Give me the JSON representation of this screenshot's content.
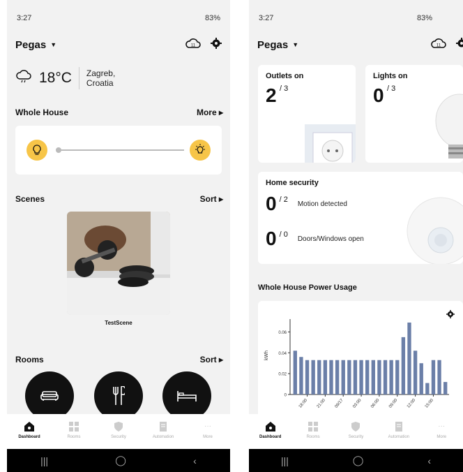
{
  "left": {
    "status": {
      "time": "3:27",
      "battery": "83%"
    },
    "home_name": "Pegas",
    "cloud_badge": "11",
    "weather": {
      "temp": "18°C",
      "city_line1": "Zagreb,",
      "city_line2": "Croatia"
    },
    "whole_house": {
      "title": "Whole House",
      "action": "More"
    },
    "scenes": {
      "title": "Scenes",
      "action": "Sort",
      "scene_name": "TestScene"
    },
    "rooms": {
      "title": "Rooms",
      "action": "Sort"
    },
    "nav": [
      {
        "label": "Dashboard",
        "icon": "home-icon"
      },
      {
        "label": "Rooms",
        "icon": "grid-icon"
      },
      {
        "label": "Security",
        "icon": "shield-icon"
      },
      {
        "label": "Automation",
        "icon": "automation-icon"
      },
      {
        "label": "More",
        "icon": "more-icon"
      }
    ]
  },
  "right": {
    "status": {
      "time": "3:27",
      "battery": "83%"
    },
    "home_name": "Pegas",
    "cloud_badge": "11",
    "outlets": {
      "title": "Outlets on",
      "value": "2",
      "total": "/ 3"
    },
    "lights": {
      "title": "Lights on",
      "value": "0",
      "total": "/ 3"
    },
    "security": {
      "title": "Home security",
      "motion_value": "0",
      "motion_total": "/ 2",
      "motion_label": "Motion detected",
      "doors_value": "0",
      "doors_total": "/ 0",
      "doors_label": "Doors/Windows open"
    },
    "power_title": "Whole House Power Usage",
    "nav": [
      {
        "label": "Dashboard"
      },
      {
        "label": "Rooms"
      },
      {
        "label": "Security"
      },
      {
        "label": "Automation"
      },
      {
        "label": "More"
      }
    ]
  },
  "chart_data": {
    "type": "bar",
    "ylabel": "kWh",
    "ylim": [
      0,
      0.075
    ],
    "yticks": [
      "0",
      "0.02",
      "0.04",
      "0.06"
    ],
    "xticks": [
      "18:00",
      "21:00",
      "09/17",
      "03:00",
      "06:00",
      "09:00",
      "12:00",
      "15:00"
    ],
    "values": [
      0.042,
      0.036,
      0.033,
      0.033,
      0.033,
      0.033,
      0.033,
      0.033,
      0.033,
      0.033,
      0.033,
      0.033,
      0.033,
      0.033,
      0.033,
      0.033,
      0.033,
      0.033,
      0.055,
      0.069,
      0.042,
      0.03,
      0.011,
      0.033,
      0.033,
      0.012
    ],
    "bar_color": "#6b7fa8"
  }
}
